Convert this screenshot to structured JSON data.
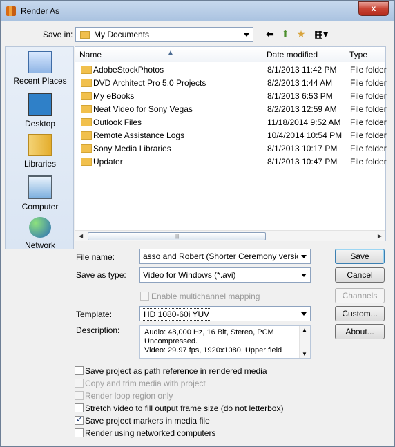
{
  "window": {
    "title": "Render As",
    "close": "x"
  },
  "save_in": {
    "label": "Save in:",
    "value": "My Documents"
  },
  "places": [
    {
      "label": "Recent Places",
      "icon": "recent-places-icon"
    },
    {
      "label": "Desktop",
      "icon": "desktop-icon"
    },
    {
      "label": "Libraries",
      "icon": "libraries-icon"
    },
    {
      "label": "Computer",
      "icon": "computer-icon"
    },
    {
      "label": "Network",
      "icon": "network-icon"
    }
  ],
  "list": {
    "headers": {
      "name": "Name",
      "date": "Date modified",
      "type": "Type"
    },
    "rows": [
      {
        "name": "AdobeStockPhotos",
        "date": "8/1/2013 11:42 PM",
        "type": "File folder"
      },
      {
        "name": "DVD Architect Pro 5.0 Projects",
        "date": "8/2/2013 1:44 AM",
        "type": "File folder"
      },
      {
        "name": "My eBooks",
        "date": "8/1/2013 6:53 PM",
        "type": "File folder"
      },
      {
        "name": "Neat Video for Sony Vegas",
        "date": "8/2/2013 12:59 AM",
        "type": "File folder"
      },
      {
        "name": "Outlook Files",
        "date": "11/18/2014 9:52 AM",
        "type": "File folder"
      },
      {
        "name": "Remote Assistance Logs",
        "date": "10/4/2014 10:54 PM",
        "type": "File folder"
      },
      {
        "name": "Sony Media Libraries",
        "date": "8/1/2013 10:17 PM",
        "type": "File folder"
      },
      {
        "name": "Updater",
        "date": "8/1/2013 10:47 PM",
        "type": "File folder"
      }
    ]
  },
  "form": {
    "file_name_label": "File name:",
    "file_name_value": "asso and Robert (Shorter Ceremony version).avi",
    "save_type_label": "Save as type:",
    "save_type_value": "Video for Windows (*.avi)",
    "multichannel_label": "Enable multichannel mapping",
    "template_label": "Template:",
    "template_value": "HD 1080-60i YUV",
    "description_label": "Description:",
    "description_lines": [
      "Audio: 48,000 Hz, 16 Bit, Stereo, PCM",
      "Uncompressed.",
      "Video: 29.97 fps, 1920x1080, Upper field"
    ]
  },
  "buttons": {
    "save": "Save",
    "cancel": "Cancel",
    "channels": "Channels",
    "custom": "Custom...",
    "about": "About..."
  },
  "options": [
    {
      "label": "Save project as path reference in rendered media",
      "checked": false,
      "enabled": true
    },
    {
      "label": "Copy and trim media with project",
      "checked": false,
      "enabled": false
    },
    {
      "label": "Render loop region only",
      "checked": false,
      "enabled": false
    },
    {
      "label": "Stretch video to fill output frame size (do not letterbox)",
      "checked": false,
      "enabled": true
    },
    {
      "label": "Save project markers in media file",
      "checked": true,
      "enabled": true
    },
    {
      "label": "Render using networked computers",
      "checked": false,
      "enabled": true
    }
  ]
}
